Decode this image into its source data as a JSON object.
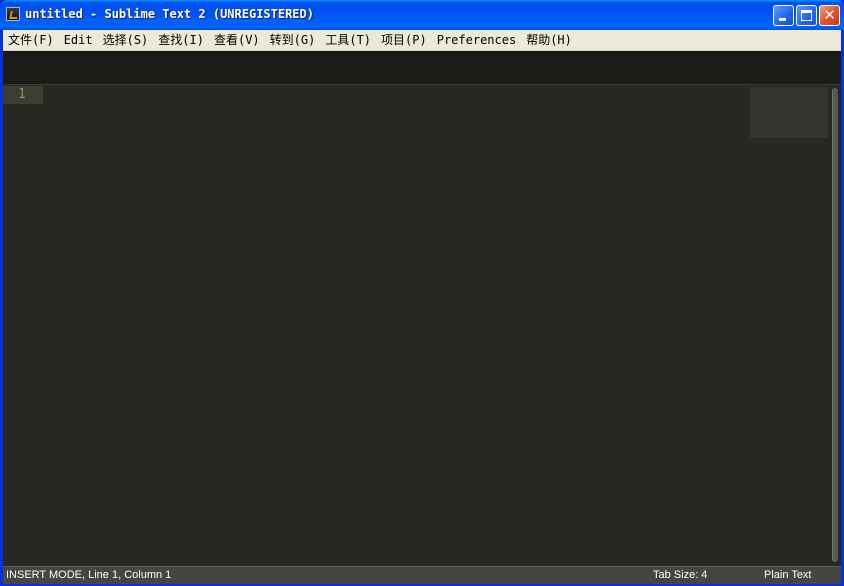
{
  "window": {
    "title": "untitled - Sublime Text 2 (UNREGISTERED)",
    "icon": "sublime-text-app-icon",
    "controls": {
      "minimize": "minimize",
      "maximize": "maximize",
      "close": "✕"
    }
  },
  "menu": [
    {
      "label": "文件(F)"
    },
    {
      "label": "Edit"
    },
    {
      "label": "选择(S)"
    },
    {
      "label": "查找(I)"
    },
    {
      "label": "查看(V)"
    },
    {
      "label": "转到(G)"
    },
    {
      "label": "工具(T)"
    },
    {
      "label": "项目(P)"
    },
    {
      "label": "Preferences"
    },
    {
      "label": "帮助(H)"
    }
  ],
  "editor": {
    "line_numbers": [
      "1"
    ],
    "colors": {
      "background": "#272822",
      "gutter_highlight": "#3e3d32",
      "line_number": "#8f908a"
    }
  },
  "status": {
    "mode_position": "INSERT MODE, Line 1, Column 1",
    "tab_size": "Tab Size: 4",
    "syntax": "Plain Text"
  }
}
